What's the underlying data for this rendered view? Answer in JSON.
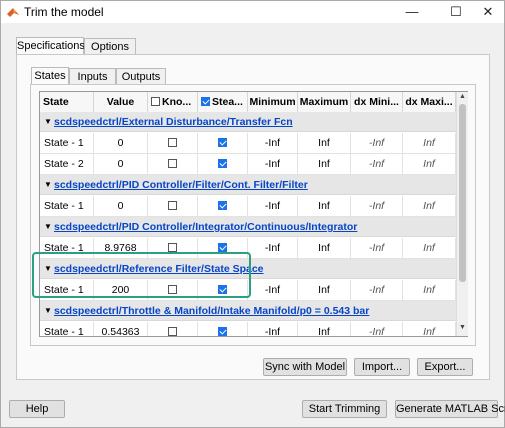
{
  "window": {
    "title": "Trim the model",
    "minimize": "—",
    "maximize": "☐",
    "close": "✕"
  },
  "outer_tabs": [
    {
      "label": "Specifications",
      "active": true
    },
    {
      "label": "Options",
      "active": false
    }
  ],
  "inner_tabs": [
    {
      "label": "States",
      "active": true
    },
    {
      "label": "Inputs",
      "active": false
    },
    {
      "label": "Outputs",
      "active": false
    }
  ],
  "table": {
    "headers": {
      "state": "State",
      "value": "Value",
      "known": "Kno...",
      "steady": "Stea...",
      "minimum": "Minimum",
      "maximum": "Maximum",
      "dxmin": "dx Mini...",
      "dxmax": "dx Maxi..."
    },
    "header_known_checked": false,
    "header_steady_checked": true,
    "groups": [
      {
        "path": "scdspeedctrl/External Disturbance/Transfer Fcn",
        "rows": [
          {
            "state": "State - 1",
            "value": "0",
            "known": false,
            "steady": true,
            "min": "-Inf",
            "max": "Inf",
            "dxmin": "-Inf",
            "dxmax": "Inf"
          },
          {
            "state": "State - 2",
            "value": "0",
            "known": false,
            "steady": true,
            "min": "-Inf",
            "max": "Inf",
            "dxmin": "-Inf",
            "dxmax": "Inf"
          }
        ]
      },
      {
        "path": "scdspeedctrl/PID Controller/Filter/Cont. Filter/Filter",
        "rows": [
          {
            "state": "State - 1",
            "value": "0",
            "known": false,
            "steady": true,
            "min": "-Inf",
            "max": "Inf",
            "dxmin": "-Inf",
            "dxmax": "Inf"
          }
        ]
      },
      {
        "path": "scdspeedctrl/PID Controller/Integrator/Continuous/Integrator",
        "rows": [
          {
            "state": "State - 1",
            "value": "8.9768",
            "known": false,
            "steady": true,
            "min": "-Inf",
            "max": "Inf",
            "dxmin": "-Inf",
            "dxmax": "Inf"
          }
        ]
      },
      {
        "path": "scdspeedctrl/Reference Filter/State Space",
        "rows": [
          {
            "state": "State - 1",
            "value": "200",
            "known": false,
            "steady": true,
            "min": "-Inf",
            "max": "Inf",
            "dxmin": "-Inf",
            "dxmax": "Inf"
          }
        ]
      },
      {
        "path": "scdspeedctrl/Throttle & Manifold/Intake Manifold/p0 = 0.543 bar",
        "rows": [
          {
            "state": "State - 1",
            "value": "0.54363",
            "known": false,
            "steady": true,
            "min": "-Inf",
            "max": "Inf",
            "dxmin": "-Inf",
            "dxmax": "Inf"
          }
        ]
      }
    ]
  },
  "buttons": {
    "sync": "Sync with Model",
    "import": "Import...",
    "export": "Export...",
    "help": "Help",
    "start": "Start Trimming",
    "generate": "Generate MATLAB Script"
  },
  "colors": {
    "highlight": "#2ba081",
    "link": "#0645c8",
    "checkbox": "#1a73e8"
  }
}
